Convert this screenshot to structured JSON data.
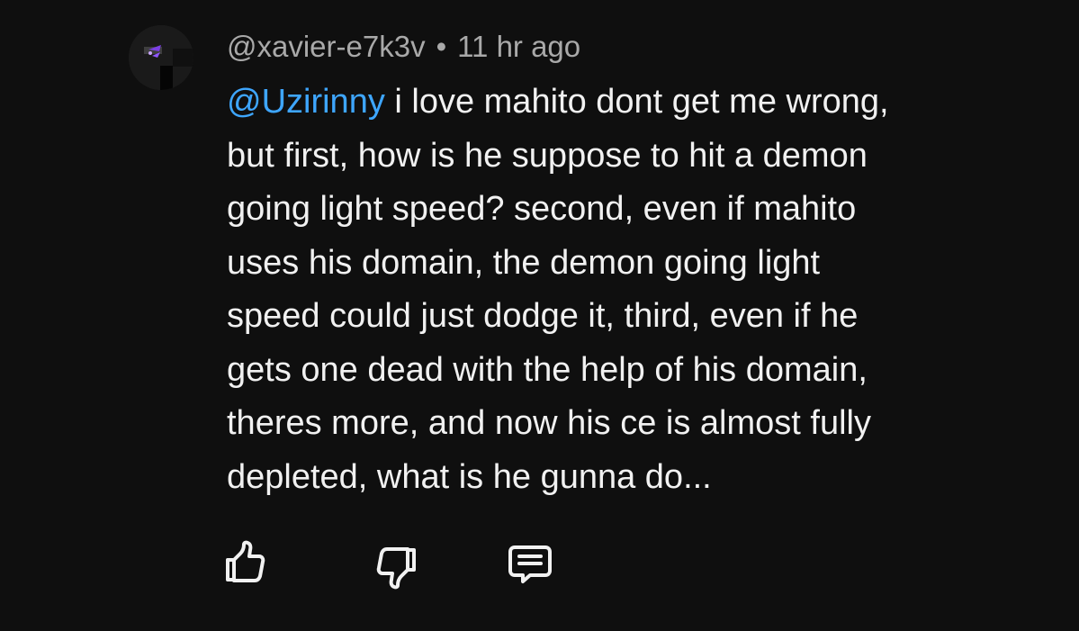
{
  "comment": {
    "author": "@xavier-e7k3v",
    "separator": "•",
    "time": "11 hr ago",
    "mention": "@Uzirinny",
    "lines": {
      "l1": " i love mahito dont get me wrong,",
      "l2": "but first, how is he suppose to hit a demon",
      "l3": "going light speed? second, even if mahito",
      "l4": "uses his domain, the demon going light",
      "l5": "speed could just dodge it, third, even if he",
      "l6": "gets one dead with the help of his domain,",
      "l7": "theres more, and now his ce is almost fully",
      "l8": "depleted, what is he gunna do..."
    }
  },
  "icons": {
    "avatar": "avatar-icon",
    "like": "thumbs-up-icon",
    "dislike": "thumbs-down-icon",
    "reply": "comment-bubble-icon"
  },
  "colors": {
    "background": "#0f0f0f",
    "text": "#f1f1f1",
    "meta": "#a9a9a9",
    "mention": "#3ea6ff",
    "avatar_accent": "#7b3fe4"
  }
}
